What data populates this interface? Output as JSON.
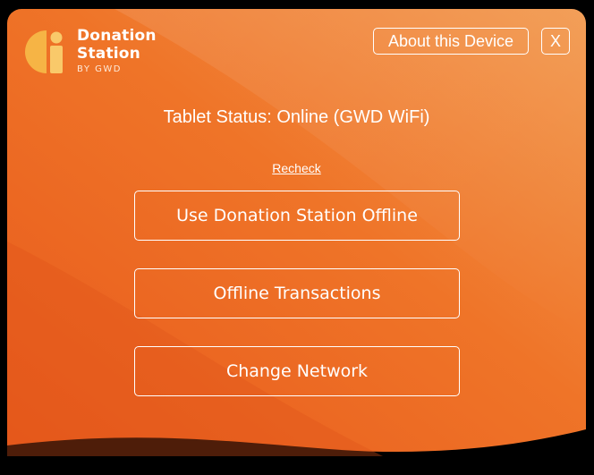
{
  "brand": {
    "name_line1": "Donation",
    "name_line2": "Station",
    "byline": "BY GWD",
    "colors": {
      "panel_orange": "#ee6a24",
      "panel_light": "#f29a50",
      "logo_yellow": "#f6b445",
      "logo_mark_light": "#f9c96a"
    }
  },
  "header": {
    "about_label": "About this Device",
    "close_label": "X"
  },
  "status": {
    "text": "Tablet Status: Online (GWD WiFi)",
    "recheck_label": "Recheck"
  },
  "actions": {
    "offline_label": "Use Donation Station Offline",
    "transactions_label": "Offline Transactions",
    "network_label": "Change Network"
  },
  "icons": {
    "logo": "donation-station-logo-icon"
  }
}
